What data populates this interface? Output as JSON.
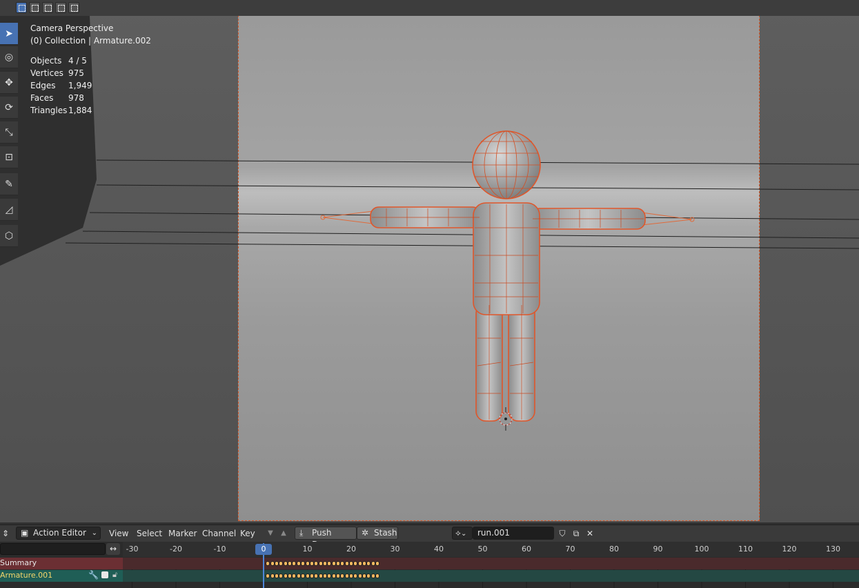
{
  "viewport": {
    "stats": {
      "title": "Camera Perspective",
      "subtitle": "(0) Collection | Armature.002",
      "rows": [
        {
          "label": "Objects",
          "value": "4 / 5"
        },
        {
          "label": "Vertices",
          "value": "975"
        },
        {
          "label": "Edges",
          "value": "1,949"
        },
        {
          "label": "Faces",
          "value": "978"
        },
        {
          "label": "Triangles",
          "value": "1,884"
        }
      ]
    },
    "colors": {
      "selection": "#d85a2a",
      "active_tool": "#4772b3"
    }
  },
  "action_editor": {
    "mode_label": "Action Editor",
    "menu": [
      "View",
      "Select",
      "Marker",
      "Channel",
      "Key"
    ],
    "push_down_label": "Push Down",
    "stash_label": "Stash",
    "action_name": "run.001",
    "channels": [
      {
        "name": "Summary"
      },
      {
        "name": "Armature.001"
      }
    ],
    "ruler_ticks": [
      "-30",
      "-20",
      "-10",
      "0",
      "10",
      "20",
      "30",
      "40",
      "50",
      "60",
      "70",
      "80",
      "90",
      "100",
      "110",
      "120",
      "130"
    ],
    "current_frame": "0",
    "colors": {
      "keyframe": "#f3b861",
      "playhead": "#4d86d9",
      "summary": "#6b2f33",
      "object_channel": "#1f5e56"
    }
  }
}
